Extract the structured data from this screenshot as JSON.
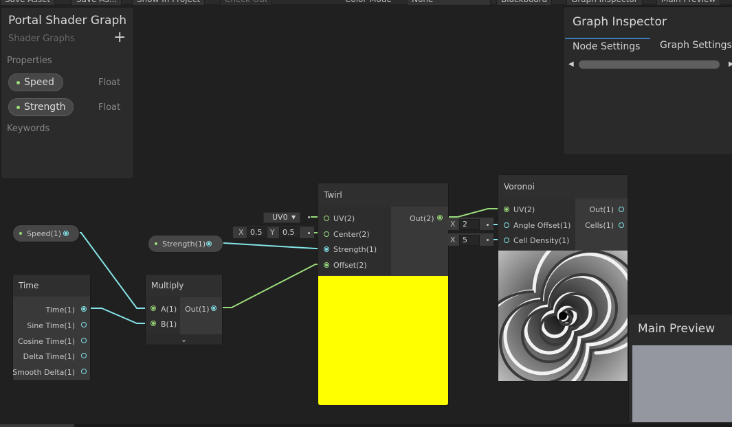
{
  "toolbar": {
    "items": [
      {
        "label": "Save Asset",
        "dim": false
      },
      {
        "label": "Save As...",
        "dim": false
      },
      {
        "label": "Show In Project",
        "dim": false
      },
      {
        "label": "Check Out",
        "dim": true
      },
      {
        "label": "Color Mode",
        "dim": false
      },
      {
        "label": "None",
        "dim": false
      },
      {
        "label": "Blackboard",
        "dim": false
      },
      {
        "label": "Graph Inspector",
        "dim": false
      },
      {
        "label": "Main Preview",
        "dim": false
      }
    ]
  },
  "blackboard": {
    "title": "Portal Shader Graph",
    "subtitle": "Shader Graphs",
    "add_symbol": "+",
    "properties_label": "Properties",
    "keywords_label": "Keywords",
    "properties": [
      {
        "name": "Speed",
        "type": "Float"
      },
      {
        "name": "Strength",
        "type": "Float"
      }
    ]
  },
  "inspector": {
    "title": "Graph Inspector",
    "tabs": [
      "Node Settings",
      "Graph Settings"
    ],
    "active_tab": "Node Settings"
  },
  "main_preview": {
    "title": "Main Preview"
  },
  "nodes": {
    "speed_prop": "Speed(1)",
    "strength_prop": "Strength(1)",
    "time": {
      "title": "Time",
      "outputs": [
        "Time(1)",
        "Sine Time(1)",
        "Cosine Time(1)",
        "Delta Time(1)",
        "Smooth Delta(1)"
      ]
    },
    "multiply": {
      "title": "Multiply",
      "inputs": [
        "A(1)",
        "B(1)"
      ],
      "output": "Out(1)",
      "expand_icon": "chevron-down-icon"
    },
    "twirl": {
      "title": "Twirl",
      "inputs": [
        "UV(2)",
        "Center(2)",
        "Strength(1)",
        "Offset(2)"
      ],
      "output": "Out(2)",
      "uv_channel": "UV0",
      "center": {
        "x_label": "X",
        "x": "0.5",
        "y_label": "Y",
        "y": "0.5"
      },
      "preview_color": "#ffff00"
    },
    "voronoi": {
      "title": "Voronoi",
      "inputs": [
        "UV(2)",
        "Angle Offset(1)",
        "Cell Density(1)"
      ],
      "outputs": [
        "Out(1)",
        "Cells(1)"
      ],
      "angle_offset": {
        "label": "X",
        "value": "2"
      },
      "cell_density": {
        "label": "X",
        "value": "5"
      }
    }
  },
  "colors": {
    "float_wire": "#84e4e7",
    "vector2_wire": "#9bdc7a",
    "accent_tab": "#3a79bb",
    "preview_background": "#9496a0"
  }
}
